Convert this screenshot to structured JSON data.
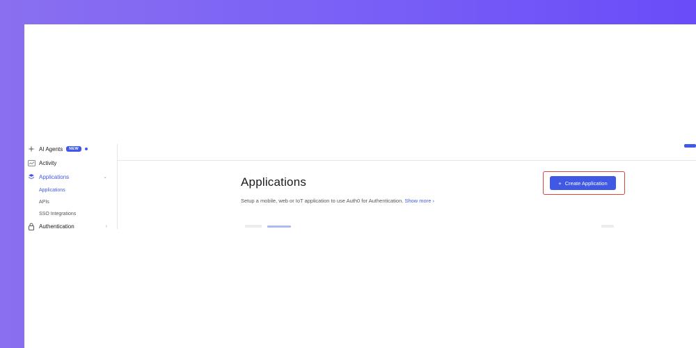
{
  "sidebar": {
    "items": [
      {
        "label": "AI Agents",
        "icon": "sparkle-icon",
        "badge": "NEW"
      },
      {
        "label": "Activity",
        "icon": "activity-icon"
      },
      {
        "label": "Applications",
        "icon": "layers-icon"
      },
      {
        "label": "Authentication",
        "icon": "lock-user-icon"
      }
    ],
    "sub_items": [
      {
        "label": "Applications"
      },
      {
        "label": "APIs"
      },
      {
        "label": "SSO Integrations"
      }
    ]
  },
  "main": {
    "title": "Applications",
    "subtitle": "Setup a mobile, web or IoT application to use Auth0 for Authentication.",
    "show_more": "Show more",
    "create_button": "Create Application"
  },
  "colors": {
    "accent": "#3f59e4",
    "highlight": "#e0423c",
    "background_gradient_start": "#8a6ff0",
    "background_gradient_end": "#6a4cf8"
  }
}
